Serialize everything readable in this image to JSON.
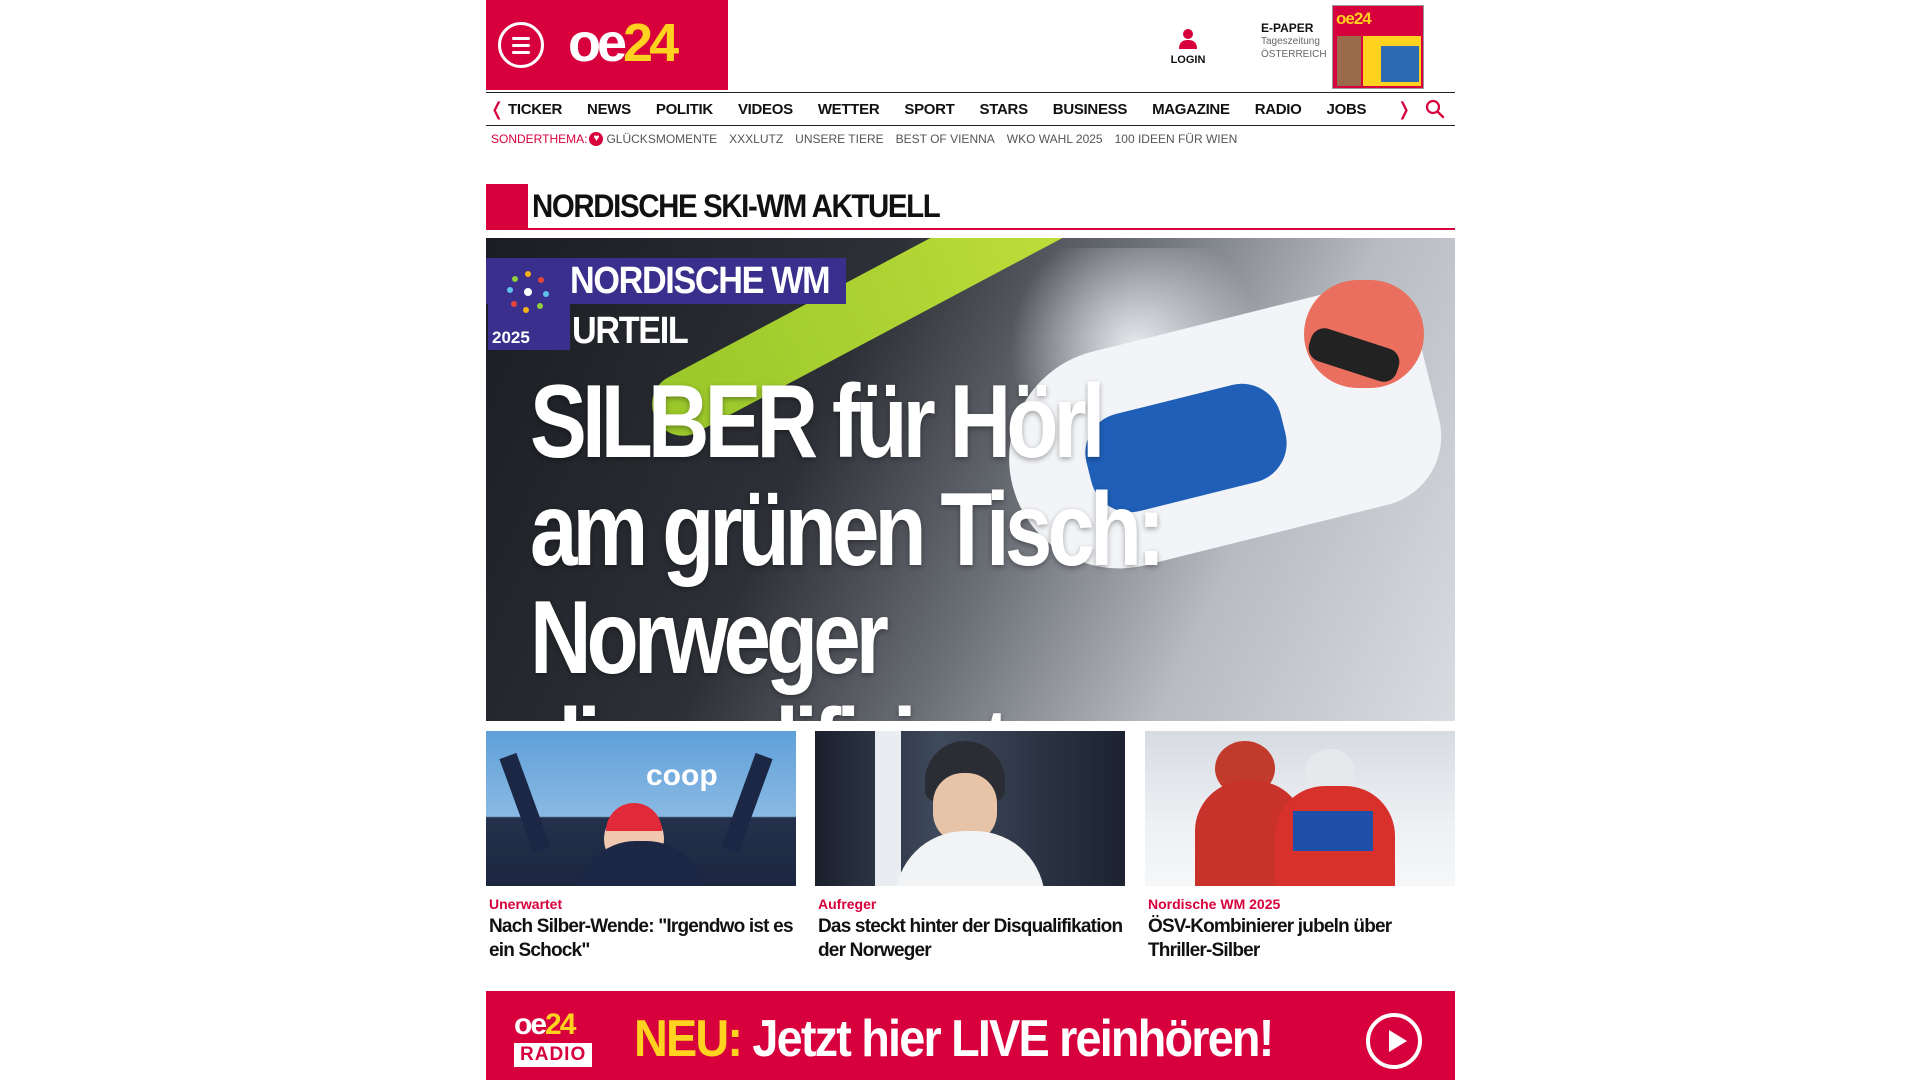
{
  "header": {
    "logo": {
      "text_oe": "oe",
      "text_24": "24"
    },
    "login_label": "LOGIN",
    "epaper": {
      "title": "E-PAPER",
      "line1": "Tageszeitung",
      "line2": "ÖSTERREICH"
    }
  },
  "nav": {
    "items": [
      "TICKER",
      "NEWS",
      "POLITIK",
      "VIDEOS",
      "WETTER",
      "SPORT",
      "STARS",
      "BUSINESS",
      "MAGAZINE",
      "RADIO",
      "JOBS"
    ]
  },
  "subnav": {
    "label": "SONDERTHEMA:",
    "items": [
      "GLÜCKSMOMENTE",
      "XXXLUTZ",
      "UNSERE TIERE",
      "BEST OF VIENNA",
      "WKO WAHL 2025",
      "100 IDEEN FÜR WIEN"
    ]
  },
  "section": {
    "title": "NORDISCHE SKI-WM AKTUELL"
  },
  "hero": {
    "badge": "NORDISCHE WM",
    "logo_year": "2025",
    "tag": "URTEIL",
    "headline_line1": "SILBER für Hörl",
    "headline_line2": "am grünen Tisch:",
    "headline_line3": "Norweger disqualifiziert"
  },
  "cards": [
    {
      "kicker": "Unerwartet",
      "title": "Nach Silber-Wende: \"Irgendwo ist es ein Schock\""
    },
    {
      "kicker": "Aufreger",
      "title": "Das steckt hinter der Disqualifikation der Norweger"
    },
    {
      "kicker": "Nordische WM 2025",
      "title": "ÖSV-Kombinierer jubeln über Thriller-Silber"
    }
  ],
  "radio_banner": {
    "logo_oe": "oe",
    "logo_24": "24",
    "logo_radio": "RADIO",
    "neu": "NEU:",
    "text": "Jetzt hier LIVE reinhören!"
  },
  "colors": {
    "brand_red": "#d8003c",
    "brand_yellow": "#ffd21f",
    "badge_purple": "#3a2f8c"
  }
}
